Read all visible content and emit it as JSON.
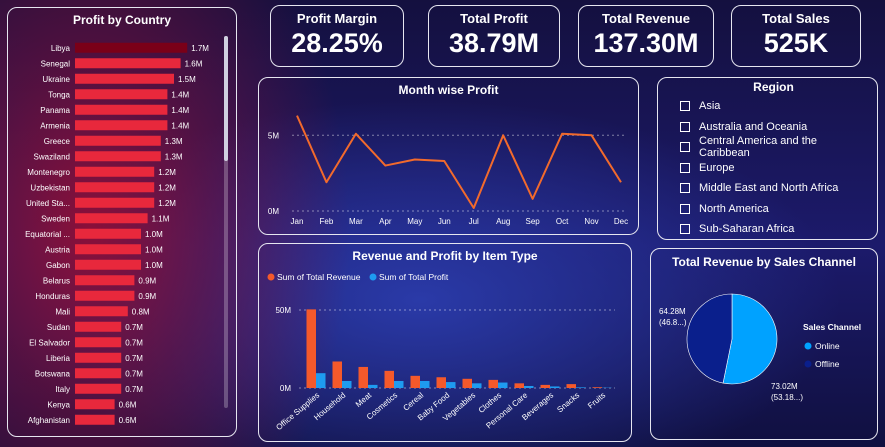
{
  "kpis": [
    {
      "label": "Profit Margin",
      "value": "28.25%"
    },
    {
      "label": "Total Profit",
      "value": "38.79M"
    },
    {
      "label": "Total Revenue",
      "value": "137.30M"
    },
    {
      "label": "Total Sales",
      "value": "525K"
    }
  ],
  "region": {
    "title": "Region",
    "items": [
      "Asia",
      "Australia and Oceania",
      "Central America and the Caribbean",
      "Europe",
      "Middle East and North Africa",
      "North America",
      "Sub-Saharan Africa"
    ]
  },
  "colors": {
    "bar_country": "#e8283c",
    "bar_country_top": "#7a0018",
    "line": "#f26a2c",
    "revenue": "#f4592b",
    "profit": "#1e9bf0",
    "online": "#00a2ff",
    "offline": "#0a1f8c"
  },
  "chart_data": [
    {
      "id": "country",
      "type": "bar",
      "orientation": "horizontal",
      "title": "Profit by Country",
      "categories": [
        "Libya",
        "Senegal",
        "Ukraine",
        "Tonga",
        "Panama",
        "Armenia",
        "Greece",
        "Swaziland",
        "Montenegro",
        "Uzbekistan",
        "United Sta...",
        "Sweden",
        "Equatorial ...",
        "Austria",
        "Gabon",
        "Belarus",
        "Honduras",
        "Mali",
        "Sudan",
        "El Salvador",
        "Liberia",
        "Botswana",
        "Italy",
        "Kenya",
        "Afghanistan"
      ],
      "values": [
        1.7,
        1.6,
        1.5,
        1.4,
        1.4,
        1.4,
        1.3,
        1.3,
        1.2,
        1.2,
        1.2,
        1.1,
        1.0,
        1.0,
        1.0,
        0.9,
        0.9,
        0.8,
        0.7,
        0.7,
        0.7,
        0.7,
        0.7,
        0.6,
        0.6
      ],
      "labels": [
        "1.7M",
        "1.6M",
        "1.5M",
        "1.4M",
        "1.4M",
        "1.4M",
        "1.3M",
        "1.3M",
        "1.2M",
        "1.2M",
        "1.2M",
        "1.1M",
        "1.0M",
        "1.0M",
        "1.0M",
        "0.9M",
        "0.9M",
        "0.8M",
        "0.7M",
        "0.7M",
        "0.7M",
        "0.7M",
        "0.7M",
        "0.6M",
        "0.6M"
      ],
      "xlim": [
        0,
        2
      ],
      "xticks": [
        0,
        1,
        2
      ],
      "xtick_labels": [
        "0M",
        "1M",
        "2M"
      ]
    },
    {
      "id": "month",
      "type": "line",
      "title": "Month wise Profit",
      "x": [
        "Jan",
        "Feb",
        "Mar",
        "Apr",
        "May",
        "Jun",
        "Jul",
        "Aug",
        "Sep",
        "Oct",
        "Nov",
        "Dec"
      ],
      "values": [
        6.3,
        1.9,
        5.1,
        3.0,
        3.4,
        3.3,
        0.2,
        5.0,
        0.8,
        5.1,
        5.0,
        1.9
      ],
      "ylim": [
        0,
        7
      ],
      "yticks": [
        0,
        5
      ],
      "ytick_labels": [
        "0M",
        "5M"
      ]
    },
    {
      "id": "itemtype",
      "type": "bar",
      "title": "Revenue and Profit by Item Type",
      "categories": [
        "Office Supplies",
        "Household",
        "Meat",
        "Cosmetics",
        "Cereal",
        "Baby Food",
        "Vegetables",
        "Clothes",
        "Personal Care",
        "Beverages",
        "Snacks",
        "Fruits"
      ],
      "series": [
        {
          "name": "Sum of Total Revenue",
          "values": [
            50.4,
            17.0,
            13.5,
            11.0,
            7.8,
            6.9,
            5.9,
            5.2,
            3.0,
            2.0,
            2.5,
            0.5
          ]
        },
        {
          "name": "Sum of Total Profit",
          "values": [
            9.5,
            4.5,
            2.0,
            4.5,
            4.5,
            3.8,
            3.0,
            3.5,
            1.3,
            1.0,
            0.4,
            0.2
          ]
        }
      ],
      "ylim": [
        0,
        60
      ],
      "yticks": [
        0,
        50
      ],
      "ytick_labels": [
        "0M",
        "50M"
      ],
      "legend": "top-left"
    },
    {
      "id": "channel",
      "type": "pie",
      "title": "Total Revenue by Sales Channel",
      "legend_title": "Sales Channel",
      "slices": [
        {
          "name": "Online",
          "value": 73.02,
          "label": "73.02M",
          "sublabel": "(53.18...)"
        },
        {
          "name": "Offline",
          "value": 64.28,
          "label": "64.28M",
          "sublabel": "(46.8...)"
        }
      ]
    }
  ]
}
